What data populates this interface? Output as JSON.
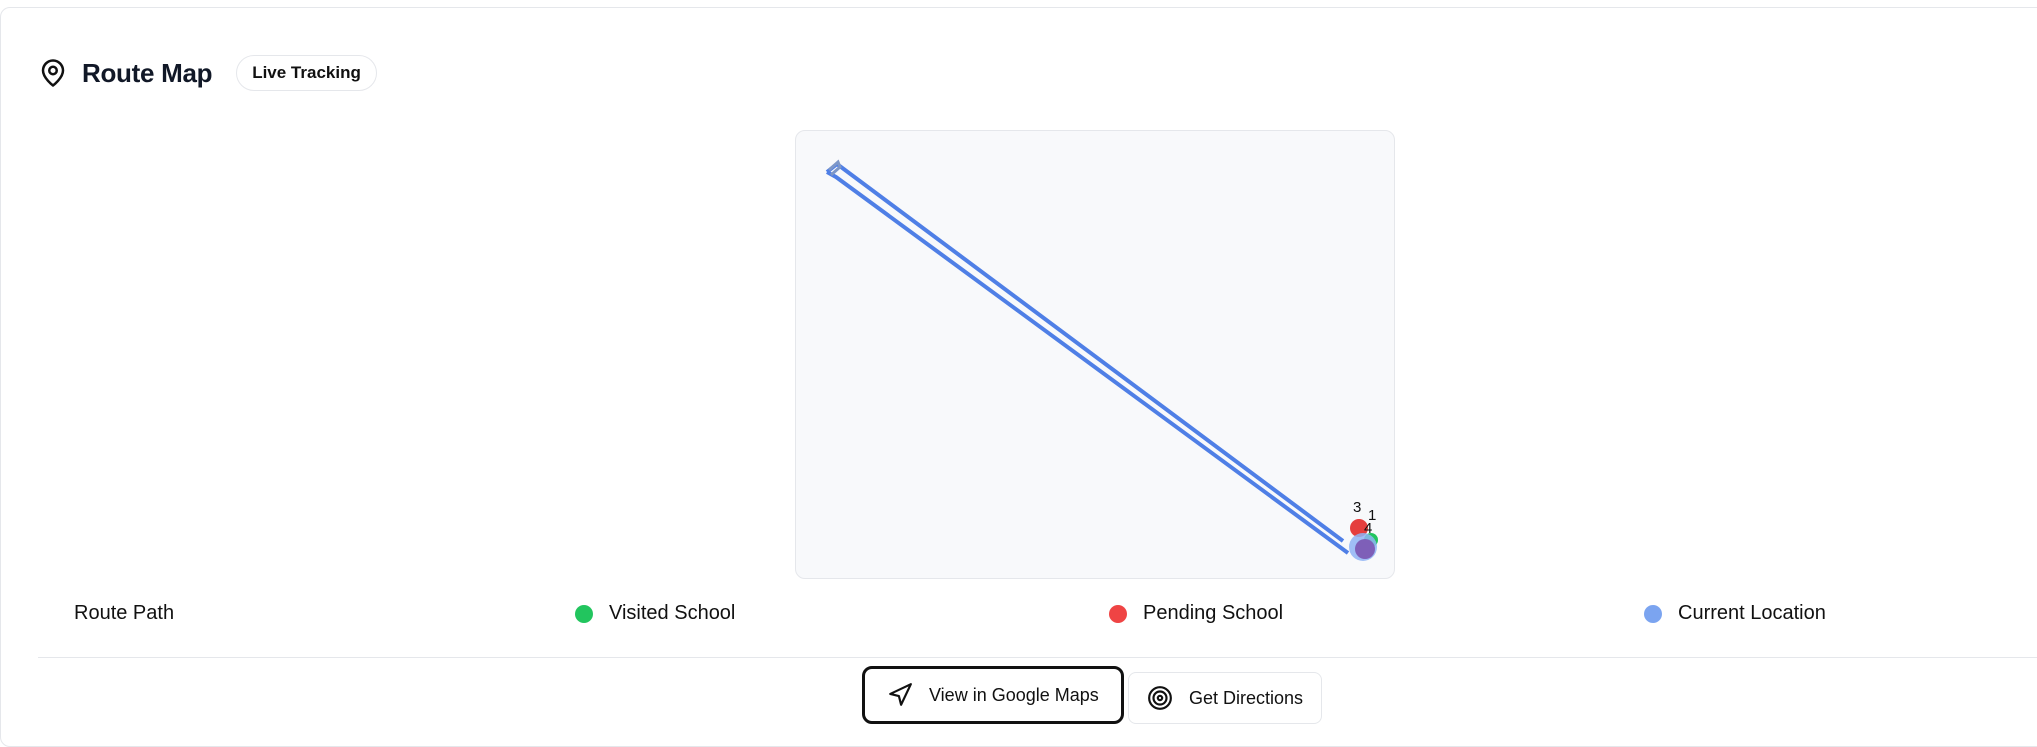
{
  "header": {
    "title": "Route Map",
    "badge": "Live Tracking",
    "icon": "map-pin-icon"
  },
  "map": {
    "route_color": "#4f7fe6",
    "markers": [
      {
        "label": "3",
        "status": "pending",
        "color": "#e53e3e"
      },
      {
        "label": "1",
        "status": "visited",
        "color": "#22c55e"
      },
      {
        "label": "4",
        "status": "current",
        "color": "#7c86e8"
      }
    ]
  },
  "legend": {
    "items": [
      {
        "label": "Route Path",
        "color": ""
      },
      {
        "label": "Visited School",
        "color": "#22c55e"
      },
      {
        "label": "Pending School",
        "color": "#ef4444"
      },
      {
        "label": "Current Location",
        "color": "#7ba4f0"
      }
    ]
  },
  "actions": {
    "google_maps": {
      "label": "View in Google Maps",
      "icon": "navigation-arrow-icon"
    },
    "directions": {
      "label": "Get Directions",
      "icon": "target-icon"
    }
  }
}
